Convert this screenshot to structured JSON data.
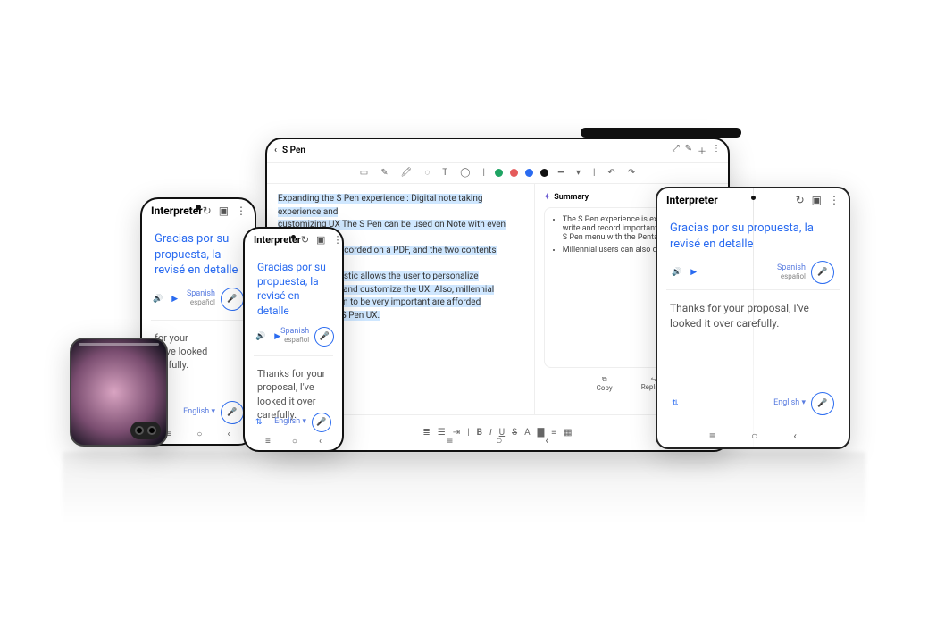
{
  "interpreter": {
    "title": "Interpreter",
    "translated_es": "Gracias por su propuesta, la revisé en detalle",
    "source_en": "Thanks for your proposal, I've looked it over carefully.",
    "lang_top_name": "Spanish",
    "lang_top_native": "español",
    "lang_bottom_name": "English"
  },
  "tablet": {
    "title": "S Pen",
    "colors": [
      "#1fa463",
      "#e55b5b",
      "#2a6bf0",
      "#111111"
    ],
    "note_segments": [
      {
        "t": "Expanding the S Pen experience : Digital note taking experience and",
        "hl": true,
        "br": true
      },
      {
        "t": "customizing UX The S Pen can be used on Note with even more freedom.",
        "hl": true,
        "br": true
      },
      {
        "t": "",
        "hl": false,
        "br": false
      },
      {
        "t": "be written and recorded on a PDF, and the two contents",
        "hl": true,
        "br": true
      },
      {
        "t": " ",
        "hl": false,
        "br": true
      },
      {
        "t": "app called Pentastic allows the user to personalize",
        "hl": true,
        "br": true
      },
      {
        "t": "s that they want and customize the UX. Also, millennial",
        "hl": true,
        "br": true
      },
      {
        "t": "rsonal expression to be very important are afforded",
        "hl": true,
        "br": true
      },
      {
        "t": "gning their own S Pen UX.",
        "hl": true,
        "br": false
      }
    ],
    "summary_label": "Summary",
    "summary_bullets": [
      "The S Pen experience is expanding with n write and record important notes on a PD; S Pen menu with the Pentastic app",
      "Millennial users can also design their ow"
    ],
    "actions": {
      "copy": "Copy",
      "replace": "Replace"
    },
    "footer_tools": [
      "list-ul",
      "list-ol",
      "indent",
      "align",
      "bold",
      "italic",
      "underline",
      "strike",
      "color",
      "highlight",
      "table",
      "link"
    ]
  }
}
